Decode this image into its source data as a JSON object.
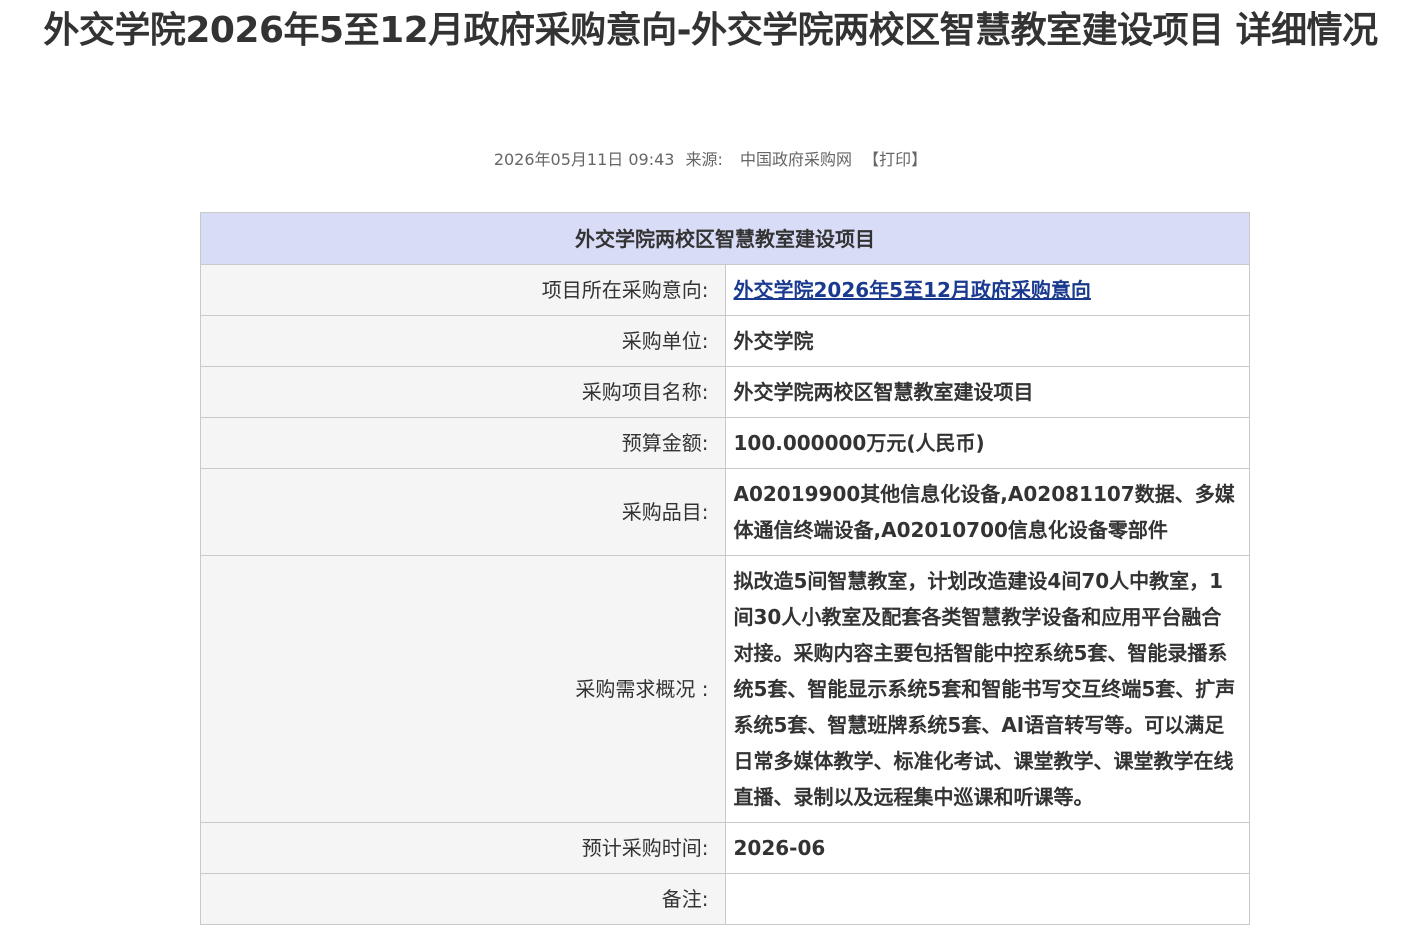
{
  "page": {
    "title": "外交学院2026年5至12月政府采购意向-外交学院两校区智慧教室建设项目 详细情况"
  },
  "meta": {
    "datetime": "2026年05月11日 09:43",
    "source_label": "来源:",
    "source": "中国政府采购网",
    "print_label": "【打印】"
  },
  "table": {
    "header": "外交学院两校区智慧教室建设项目",
    "rows": [
      {
        "label": "项目所在采购意向:",
        "value": "外交学院2026年5至12月政府采购意向"
      },
      {
        "label": "采购单位:",
        "value": "外交学院"
      },
      {
        "label": "采购项目名称:",
        "value": "外交学院两校区智慧教室建设项目"
      },
      {
        "label": "预算金额:",
        "value": "100.000000万元(人民币)"
      },
      {
        "label": "采购品目:",
        "value": "A02019900其他信息化设备,A02081107数据、多媒体通信终端设备,A02010700信息化设备零部件"
      },
      {
        "label": "采购需求概况 :",
        "value": "拟改造5间智慧教室，计划改造建设4间70人中教室，1间30人小教室及配套各类智慧教学设备和应用平台融合对接。采购内容主要包括智能中控系统5套、智能录播系统5套、智能显示系统5套和智能书写交互终端5套、扩声系统5套、智慧班牌系统5套、AI语音转写等。可以满足日常多媒体教学、标准化考试、课堂教学、课堂教学在线直播、录制以及远程集中巡课和听课等。"
      },
      {
        "label": "预计采购时间:",
        "value": "2026-06"
      },
      {
        "label": "备注:",
        "value": ""
      }
    ]
  }
}
